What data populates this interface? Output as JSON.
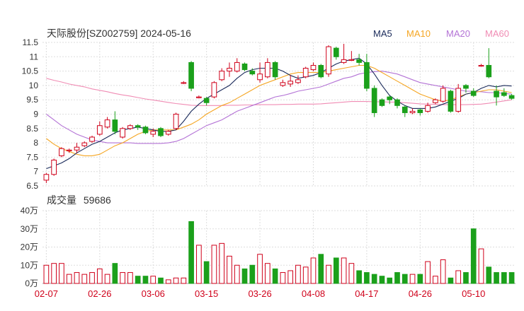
{
  "chart_data": {
    "type": "candlestick",
    "title": "天际股份[SZ002759] 2024-05-16",
    "legend": [
      {
        "name": "MA5",
        "color": "#1a2a5a"
      },
      {
        "name": "MA10",
        "color": "#f5a623"
      },
      {
        "name": "MA20",
        "color": "#b473d6"
      },
      {
        "name": "MA60",
        "color": "#f08cb4"
      }
    ],
    "colors": {
      "up": "#d0021b",
      "down": "#1ba01b",
      "grid": "#dddddd"
    },
    "y_ticks": [
      "11.5",
      "11",
      "10.5",
      "10",
      "9.5",
      "9",
      "8.5",
      "8",
      "7.5",
      "7",
      "6.5"
    ],
    "ylim": [
      6.5,
      11.5
    ],
    "x_ticks": [
      "02-07",
      "02-26",
      "03-06",
      "03-15",
      "03-26",
      "04-08",
      "04-17",
      "04-26",
      "05-10"
    ],
    "x_tick_index": [
      0,
      7,
      14,
      21,
      28,
      35,
      42,
      49,
      56
    ],
    "candles": [
      [
        6.7,
        6.9,
        6.6,
        6.95
      ],
      [
        6.9,
        7.4,
        6.85,
        7.45
      ],
      [
        7.55,
        7.8,
        7.5,
        7.85
      ],
      [
        7.75,
        7.75,
        7.65,
        7.8
      ],
      [
        7.75,
        7.85,
        7.65,
        8.0
      ],
      [
        7.9,
        8.0,
        7.85,
        8.05
      ],
      [
        8.05,
        8.2,
        8.0,
        8.25
      ],
      [
        8.3,
        8.6,
        8.25,
        8.75
      ],
      [
        8.55,
        8.8,
        8.5,
        8.9
      ],
      [
        8.8,
        8.4,
        8.3,
        9.1
      ],
      [
        8.2,
        8.5,
        8.15,
        8.55
      ],
      [
        8.5,
        8.6,
        8.45,
        8.65
      ],
      [
        8.6,
        8.55,
        8.45,
        8.65
      ],
      [
        8.55,
        8.35,
        8.3,
        8.6
      ],
      [
        8.3,
        8.4,
        8.2,
        8.5
      ],
      [
        8.5,
        8.25,
        8.2,
        8.55
      ],
      [
        8.3,
        8.4,
        8.25,
        8.45
      ],
      [
        8.5,
        9.0,
        8.45,
        9.05
      ],
      [
        10.1,
        10.1,
        10.05,
        10.15
      ],
      [
        10.8,
        9.9,
        9.8,
        10.85
      ],
      [
        9.6,
        9.6,
        9.55,
        9.65
      ],
      [
        9.55,
        9.4,
        9.3,
        9.6
      ],
      [
        9.6,
        10.1,
        9.55,
        10.15
      ],
      [
        10.2,
        10.5,
        10.15,
        10.6
      ],
      [
        10.5,
        10.6,
        10.3,
        10.8
      ],
      [
        10.5,
        10.8,
        10.45,
        10.95
      ],
      [
        10.75,
        10.55,
        10.5,
        10.8
      ],
      [
        10.5,
        10.4,
        10.35,
        10.6
      ],
      [
        10.2,
        10.4,
        10.1,
        10.8
      ],
      [
        10.3,
        10.8,
        10.25,
        10.95
      ],
      [
        10.8,
        10.3,
        10.2,
        10.85
      ],
      [
        10.0,
        10.1,
        9.95,
        10.2
      ],
      [
        10.05,
        10.15,
        9.95,
        10.35
      ],
      [
        10.1,
        10.2,
        10.05,
        10.35
      ],
      [
        10.3,
        10.6,
        10.25,
        10.65
      ],
      [
        10.55,
        10.7,
        10.5,
        10.8
      ],
      [
        10.7,
        10.3,
        10.25,
        10.75
      ],
      [
        10.4,
        11.35,
        10.3,
        11.4
      ],
      [
        11.3,
        11.0,
        10.9,
        11.35
      ],
      [
        10.8,
        10.9,
        10.75,
        11.45
      ],
      [
        10.9,
        10.9,
        10.85,
        11.2
      ],
      [
        10.9,
        10.8,
        10.7,
        11.1
      ],
      [
        10.8,
        9.9,
        9.8,
        11.1
      ],
      [
        9.9,
        9.05,
        8.9,
        10.0
      ],
      [
        9.5,
        9.3,
        9.25,
        9.55
      ],
      [
        9.6,
        9.5,
        9.35,
        9.65
      ],
      [
        9.5,
        9.3,
        9.2,
        9.55
      ],
      [
        9.25,
        9.05,
        8.9,
        9.3
      ],
      [
        9.05,
        9.1,
        9.0,
        9.2
      ],
      [
        9.15,
        9.05,
        8.95,
        9.2
      ],
      [
        9.1,
        9.3,
        9.05,
        9.4
      ],
      [
        9.4,
        9.5,
        9.35,
        9.55
      ],
      [
        9.45,
        9.9,
        9.4,
        10.0
      ],
      [
        9.8,
        9.1,
        9.05,
        9.85
      ],
      [
        9.1,
        9.9,
        9.05,
        10.05
      ],
      [
        10.0,
        9.9,
        9.75,
        10.05
      ],
      [
        9.8,
        9.65,
        9.6,
        9.9
      ],
      [
        10.7,
        10.7,
        10.65,
        10.75
      ],
      [
        10.7,
        10.3,
        10.25,
        11.3
      ],
      [
        9.8,
        9.6,
        9.3,
        10.0
      ],
      [
        9.75,
        9.65,
        9.6,
        9.9
      ],
      [
        9.65,
        9.55,
        9.5,
        9.7
      ]
    ],
    "ma5": [
      7.1,
      7.2,
      7.3,
      7.45,
      7.65,
      7.8,
      7.95,
      8.05,
      8.2,
      8.35,
      8.45,
      8.5,
      8.55,
      8.5,
      8.45,
      8.4,
      8.4,
      8.45,
      8.75,
      9.1,
      9.35,
      9.55,
      9.7,
      9.85,
      10.0,
      10.25,
      10.45,
      10.55,
      10.6,
      10.6,
      10.6,
      10.5,
      10.35,
      10.25,
      10.3,
      10.35,
      10.45,
      10.6,
      10.75,
      10.85,
      10.9,
      10.95,
      10.75,
      10.4,
      10.0,
      9.65,
      9.45,
      9.3,
      9.2,
      9.2,
      9.2,
      9.25,
      9.35,
      9.45,
      9.55,
      9.7,
      9.75,
      9.9,
      10.0,
      9.95,
      10.0,
      9.98
    ],
    "ma10": [
      8.15,
      7.95,
      7.8,
      7.7,
      7.6,
      7.55,
      7.55,
      7.6,
      7.75,
      7.9,
      8.0,
      8.15,
      8.3,
      8.4,
      8.45,
      8.45,
      8.45,
      8.45,
      8.55,
      8.65,
      8.8,
      9.0,
      9.15,
      9.3,
      9.4,
      9.55,
      9.7,
      9.85,
      10.0,
      10.1,
      10.2,
      10.3,
      10.4,
      10.45,
      10.45,
      10.45,
      10.45,
      10.5,
      10.55,
      10.6,
      10.65,
      10.7,
      10.7,
      10.6,
      10.45,
      10.3,
      10.15,
      10.0,
      9.85,
      9.7,
      9.6,
      9.5,
      9.45,
      9.5,
      9.6,
      9.7,
      9.75,
      9.8,
      9.85,
      9.85,
      9.8,
      9.75
    ],
    "ma20": [
      9.0,
      8.8,
      8.6,
      8.45,
      8.3,
      8.2,
      8.1,
      8.05,
      8.0,
      8.0,
      8.0,
      8.0,
      7.98,
      7.98,
      7.98,
      7.98,
      8.0,
      8.05,
      8.15,
      8.3,
      8.45,
      8.6,
      8.7,
      8.8,
      8.95,
      9.1,
      9.2,
      9.3,
      9.4,
      9.5,
      9.6,
      9.65,
      9.72,
      9.8,
      9.85,
      9.9,
      9.95,
      10.05,
      10.15,
      10.25,
      10.3,
      10.4,
      10.45,
      10.48,
      10.5,
      10.45,
      10.4,
      10.3,
      10.2,
      10.1,
      10.05,
      10.0,
      9.95,
      9.9,
      9.85,
      9.8,
      9.8,
      9.78,
      9.75,
      9.75,
      9.72,
      9.7
    ],
    "ma60": [
      10.25,
      10.18,
      10.12,
      10.05,
      10.0,
      9.95,
      9.88,
      9.83,
      9.78,
      9.72,
      9.67,
      9.63,
      9.58,
      9.53,
      9.49,
      9.45,
      9.41,
      9.37,
      9.34,
      9.31,
      9.3,
      9.3,
      9.3,
      9.3,
      9.31,
      9.31,
      9.32,
      9.32,
      9.33,
      9.33,
      9.33,
      9.34,
      9.34,
      9.35,
      9.35,
      9.35,
      9.36,
      9.38,
      9.4,
      9.42,
      9.44,
      9.44,
      9.44,
      9.43,
      9.43,
      9.42,
      9.42,
      9.4,
      9.38,
      9.36,
      9.35,
      9.34,
      9.33,
      9.33,
      9.33,
      9.33,
      9.34,
      9.35,
      9.38,
      9.42,
      9.46,
      9.5
    ],
    "volume_label_prefix": "成交量",
    "volume_label_value": "59686",
    "volume_ticks": [
      "40万",
      "30万",
      "20万",
      "10万",
      "0万"
    ],
    "volume_ylim": [
      0,
      40
    ],
    "volumes": [
      10,
      11,
      11,
      5,
      6,
      5,
      6,
      8,
      5,
      11,
      6,
      6,
      4,
      4,
      4,
      3,
      2,
      3,
      3,
      34,
      21,
      12,
      21,
      22,
      15,
      10,
      8,
      10,
      16,
      11,
      8,
      6,
      7,
      10,
      9,
      14,
      16,
      10,
      14,
      14,
      11,
      7,
      6,
      5,
      4,
      3,
      6,
      5,
      5,
      5,
      12,
      4,
      13,
      3,
      7,
      6,
      30,
      19,
      9,
      6,
      6,
      6
    ]
  }
}
